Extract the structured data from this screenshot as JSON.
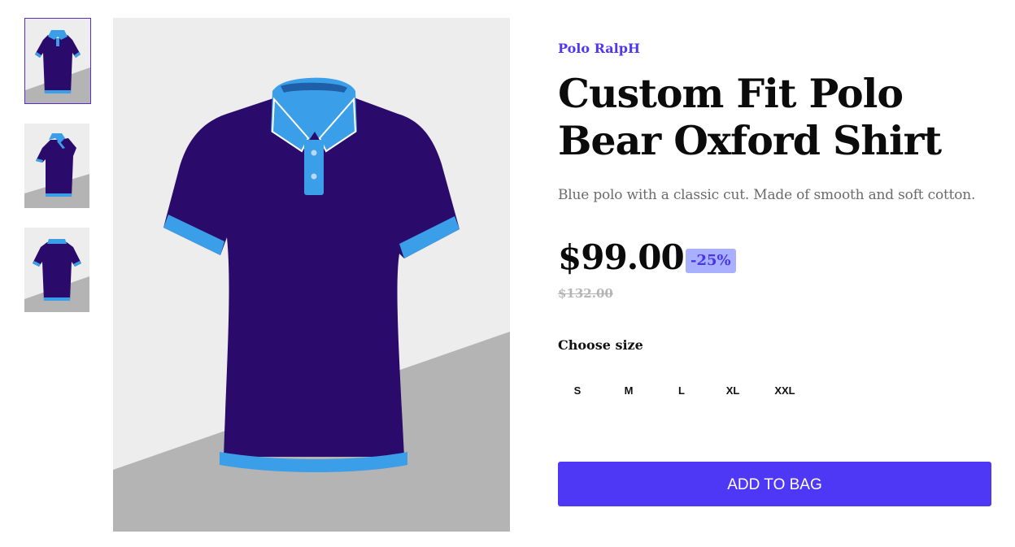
{
  "product": {
    "brand": "Polo RalpH",
    "title": "Custom Fit Polo Bear Oxford Shirt",
    "description": "Blue polo with a classic cut. Made of smooth and soft cotton.",
    "price": "$99.00",
    "discount": "-25%",
    "old_price": "$132.00"
  },
  "size_selector": {
    "label": "Choose size",
    "options": [
      "S",
      "M",
      "L",
      "XL",
      "XXL"
    ]
  },
  "cart": {
    "add_label": "ADD TO BAG"
  },
  "gallery": {
    "thumbnails": [
      {
        "name": "front-view"
      },
      {
        "name": "side-view"
      },
      {
        "name": "back-view"
      }
    ],
    "selected_index": 0
  },
  "colors": {
    "accent": "#4f38f5",
    "shirt_body": "#2a0a6a",
    "shirt_trim": "#3a9ee8",
    "discount_bg": "#a8b0ff"
  }
}
